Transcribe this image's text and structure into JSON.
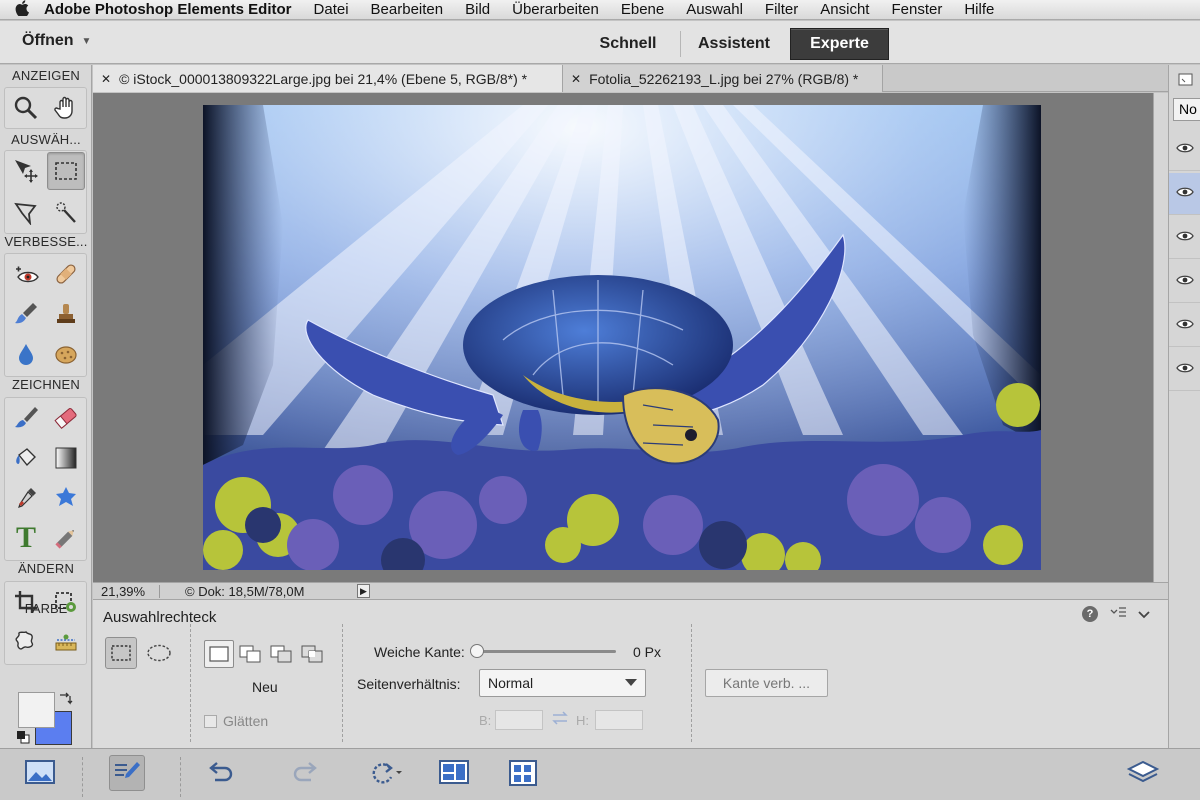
{
  "menubar": {
    "apple": "",
    "app_name": "Adobe Photoshop Elements Editor",
    "items": [
      "Datei",
      "Bearbeiten",
      "Bild",
      "Überarbeiten",
      "Ebene",
      "Auswahl",
      "Filter",
      "Ansicht",
      "Fenster",
      "Hilfe"
    ]
  },
  "topbar": {
    "open_label": "Öffnen",
    "modes": {
      "schnell": "Schnell",
      "assistent": "Assistent",
      "experte": "Experte"
    },
    "active_mode": "Experte"
  },
  "tools": {
    "sections": {
      "anzeigen": "ANZEIGEN",
      "auswahl": "AUSWÄH...",
      "verbessern": "VERBESSE...",
      "zeichnen": "ZEICHNEN",
      "aendern": "ÄNDERN",
      "farbe": "FARBE"
    },
    "zeichnen_text_tool": "T",
    "active_tool": "rectangular-marquee"
  },
  "documents": {
    "tabs": [
      {
        "title": "© iStock_000013809322Large.jpg bei 21,4% (Ebene 5, RGB/8*) *",
        "active": true
      },
      {
        "title": "Fotolia_52262193_L.jpg bei 27% (RGB/8) *",
        "active": false
      }
    ]
  },
  "status": {
    "zoom": "21,39%",
    "doc": "© Dok: 18,5M/78,0M"
  },
  "options": {
    "tool_name": "Auswahlrechteck",
    "mode_label": "Neu",
    "glaetten_label": "Glätten",
    "weiche_kante_label": "Weiche Kante:",
    "weiche_kante_value": 0,
    "weiche_kante_display": "0 Px",
    "seitenverhaeltnis_label": "Seitenverhältnis:",
    "seitenverhaeltnis_value": "Normal",
    "b_label": "B:",
    "h_label": "H:",
    "kante_button": "Kante verb. ..."
  },
  "right_panel": {
    "field_value": "No",
    "layer_count": 6,
    "selected_layer_index": 1
  },
  "colors": {
    "foreground": "#f2f2f2",
    "background": "#5b7ef0",
    "active_mode_bg": "#3c3c3c",
    "selected_layer": "#b9c8e6"
  }
}
